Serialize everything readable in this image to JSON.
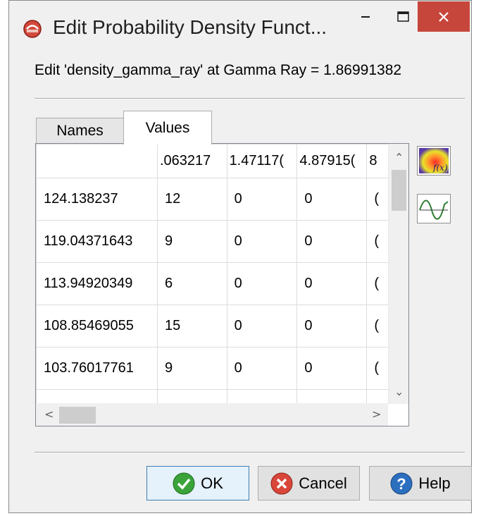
{
  "window": {
    "title": "Edit Probability Density Funct...",
    "controls": {
      "minimize": "–",
      "maximize": "☐",
      "close": "✕"
    }
  },
  "header": {
    "label": "Edit 'density_gamma_ray' at Gamma Ray = 1.86991382"
  },
  "tabs": [
    {
      "label": "Names",
      "selected": false
    },
    {
      "label": "Values",
      "selected": true
    }
  ],
  "table": {
    "columns": [
      "",
      ".063217",
      "1.47117(",
      "4.87915(",
      "8"
    ],
    "rows": [
      [
        "124.138237",
        "12",
        "0",
        "0",
        "("
      ],
      [
        "119.04371643",
        "9",
        "0",
        "0",
        "("
      ],
      [
        "113.94920349",
        "6",
        "0",
        "0",
        "("
      ],
      [
        "108.85469055",
        "15",
        "0",
        "0",
        "("
      ],
      [
        "103.76017761",
        "9",
        "0",
        "0",
        "("
      ],
      [
        "",
        "",
        "",
        "",
        ""
      ]
    ]
  },
  "side_icons": [
    {
      "name": "density-plot-icon",
      "label": "f(x)"
    },
    {
      "name": "curve-icon"
    }
  ],
  "buttons": {
    "ok": "OK",
    "cancel": "Cancel",
    "help": "Help"
  },
  "colors": {
    "ok_green": "#3aa33a",
    "cancel_red": "#d9463a",
    "help_blue": "#2c6fbf",
    "close_red": "#c7463c"
  }
}
